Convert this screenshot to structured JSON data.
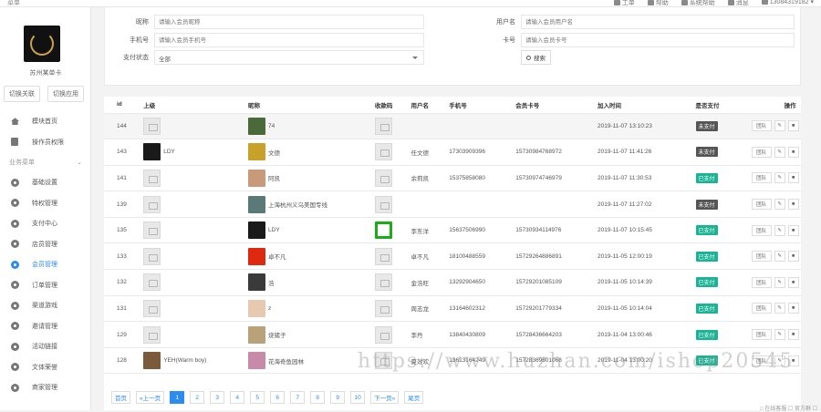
{
  "topbar": {
    "brand": "菜单",
    "links": [
      "工单",
      "帮助",
      "系统帮助",
      "消息",
      "13084319182"
    ]
  },
  "sidebar": {
    "shop_name": "苏州某单卡",
    "switch_buttons": [
      "切换关联",
      "切换应用"
    ],
    "top_items": [
      {
        "label": "模块首页",
        "icon": "home-icon"
      },
      {
        "label": "操作员权限",
        "icon": "document-icon"
      }
    ],
    "section_label": "业务菜单",
    "items": [
      {
        "label": "基础设置",
        "icon": "gear-icon"
      },
      {
        "label": "特权管理",
        "icon": "gear-icon"
      },
      {
        "label": "支付中心",
        "icon": "gear-icon"
      },
      {
        "label": "店员管理",
        "icon": "gear-icon"
      },
      {
        "label": "会员管理",
        "icon": "gear-icon",
        "active": true
      },
      {
        "label": "订单管理",
        "icon": "gear-icon"
      },
      {
        "label": "渠道游戏",
        "icon": "gear-icon"
      },
      {
        "label": "邀请管理",
        "icon": "gear-icon"
      },
      {
        "label": "活动链接",
        "icon": "gear-icon"
      },
      {
        "label": "文体荣誉",
        "icon": "gear-icon"
      },
      {
        "label": "商家管理",
        "icon": "gear-icon"
      }
    ]
  },
  "filters": {
    "nickname_label": "昵称",
    "nickname_placeholder": "请输入会员昵称",
    "username_label": "用户名",
    "username_placeholder": "请输入会员用户名",
    "phone_label": "手机号",
    "phone_placeholder": "请输入会员手机号",
    "card_label": "卡号",
    "card_placeholder": "请输入会员卡号",
    "paystatus_label": "支付状态",
    "paystatus_value": "全部",
    "search_label": "搜索"
  },
  "table": {
    "headers": [
      "id",
      "上级",
      "昵称",
      "收款码",
      "用户名",
      "手机号",
      "会员卡号",
      "加入时间",
      "是否支付",
      "操作"
    ],
    "rows": [
      {
        "id": "144",
        "parent": "",
        "nick": "74",
        "user": "",
        "phone": "",
        "card": "",
        "time": "2019-11-07 13:10:23",
        "paid": "未支付",
        "paid_status": "no",
        "qr": false,
        "avatar": "#4a6a3a",
        "parent_avatar": ""
      },
      {
        "id": "143",
        "parent": "LDY",
        "nick": "文德",
        "user": "任文德",
        "phone": "17303909396",
        "card": "15730984768972",
        "time": "2019-11-07 11:41:26",
        "paid": "未支付",
        "paid_status": "no",
        "qr": false,
        "avatar": "#c8a12a",
        "parent_avatar": "#1a1a1a"
      },
      {
        "id": "141",
        "parent": "",
        "nick": "阿凯",
        "user": "余莉凯",
        "phone": "15375858080",
        "card": "15730974746979",
        "time": "2019-11-07 11:30:53",
        "paid": "已支付",
        "paid_status": "yes",
        "qr": false,
        "avatar": "#c89a7a",
        "parent_avatar": ""
      },
      {
        "id": "139",
        "parent": "",
        "nick": "上海杭州义乌美国专线",
        "user": "",
        "phone": "",
        "card": "",
        "time": "2019-11-07 11:27:02",
        "paid": "未支付",
        "paid_status": "no",
        "qr": false,
        "avatar": "#5a7a7a",
        "parent_avatar": ""
      },
      {
        "id": "135",
        "parent": "",
        "nick": "LDY",
        "user": "李东洋",
        "phone": "15637506990",
        "card": "15730934114976",
        "time": "2019-11-07 10:15:45",
        "paid": "已支付",
        "paid_status": "yes",
        "qr": true,
        "avatar": "#1a1a1a",
        "parent_avatar": ""
      },
      {
        "id": "133",
        "parent": "",
        "nick": "卓不凡",
        "user": "卓不凡",
        "phone": "18100488559",
        "card": "15729264886891",
        "time": "2019-11-05 12:00:19",
        "paid": "已支付",
        "paid_status": "yes",
        "qr": false,
        "avatar": "#de2910",
        "parent_avatar": ""
      },
      {
        "id": "132",
        "parent": "",
        "nick": "浩",
        "user": "金浩旺",
        "phone": "13292904650",
        "card": "15729201085109",
        "time": "2019-11-05 10:14:39",
        "paid": "已支付",
        "paid_status": "yes",
        "qr": false,
        "avatar": "#3a3a3a",
        "parent_avatar": ""
      },
      {
        "id": "131",
        "parent": "",
        "nick": "z",
        "user": "周志龙",
        "phone": "13164602312",
        "card": "15729201779334",
        "time": "2019-11-05 10:14:04",
        "paid": "已支付",
        "paid_status": "yes",
        "qr": false,
        "avatar": "#e6c9b0",
        "parent_avatar": ""
      },
      {
        "id": "129",
        "parent": "",
        "nick": "烧猪子",
        "user": "李丹",
        "phone": "13840430809",
        "card": "15728436664203",
        "time": "2019-11-04 13:00:46",
        "paid": "已支付",
        "paid_status": "yes",
        "qr": false,
        "avatar": "#b9a27a",
        "parent_avatar": ""
      },
      {
        "id": "128",
        "parent": "YEH(Warm boy)",
        "nick": "花海奇鱼园林",
        "user": "夏效欢",
        "phone": "13613164249",
        "card": "15728369601068",
        "time": "2019-11-04 13:00:20",
        "paid": "已支付",
        "paid_status": "yes",
        "qr": false,
        "avatar": "#c78aa8",
        "parent_avatar": "#7a5a3a"
      }
    ],
    "op_labels": [
      "团队",
      "编辑",
      "删除"
    ]
  },
  "pager": {
    "first": "首页",
    "prev": "«上一页",
    "pages": [
      "1",
      "2",
      "3",
      "4",
      "5",
      "6",
      "7",
      "8",
      "9",
      "10"
    ],
    "current": "1",
    "next": "下一页»",
    "last": "尾页"
  },
  "watermark": "https://www.huzhan.com/ishop20545",
  "footer_hint": "□ 在线客服  ☐ 官方群 ☐"
}
